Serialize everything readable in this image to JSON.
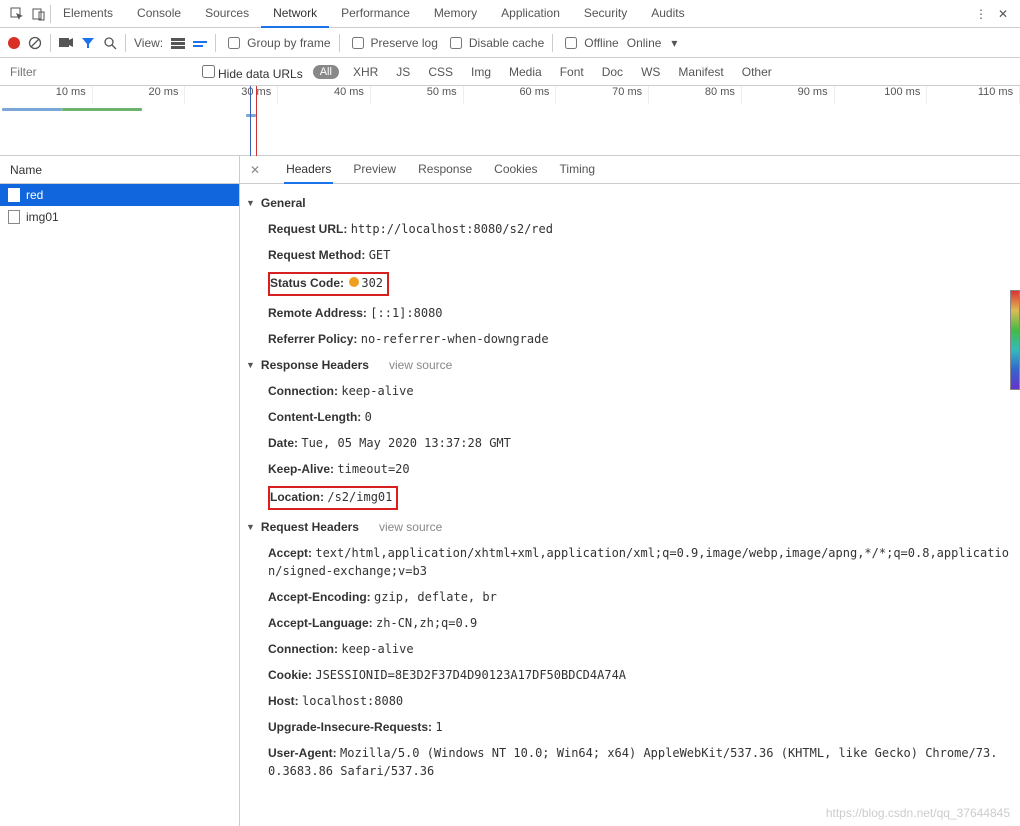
{
  "tabs": {
    "elements": "Elements",
    "console": "Console",
    "sources": "Sources",
    "network": "Network",
    "performance": "Performance",
    "memory": "Memory",
    "application": "Application",
    "security": "Security",
    "audits": "Audits"
  },
  "toolbar": {
    "view": "View:",
    "group_by_frame": "Group by frame",
    "preserve_log": "Preserve log",
    "disable_cache": "Disable cache",
    "offline": "Offline",
    "online": "Online"
  },
  "filterbar": {
    "placeholder": "Filter",
    "hide_data_urls": "Hide data URLs",
    "all": "All",
    "types": [
      "XHR",
      "JS",
      "CSS",
      "Img",
      "Media",
      "Font",
      "Doc",
      "WS",
      "Manifest",
      "Other"
    ]
  },
  "timeline_ticks": [
    "10 ms",
    "20 ms",
    "30 ms",
    "40 ms",
    "50 ms",
    "60 ms",
    "70 ms",
    "80 ms",
    "90 ms",
    "100 ms",
    "110 ms"
  ],
  "names": {
    "header": "Name",
    "items": [
      "red",
      "img01"
    ],
    "selected_index": 0
  },
  "detail_tabs": [
    "Headers",
    "Preview",
    "Response",
    "Cookies",
    "Timing"
  ],
  "general": {
    "title": "General",
    "request_url_k": "Request URL:",
    "request_url_v": "http://localhost:8080/s2/red",
    "request_method_k": "Request Method:",
    "request_method_v": "GET",
    "status_code_k": "Status Code:",
    "status_code_v": "302",
    "remote_addr_k": "Remote Address:",
    "remote_addr_v": "[::1]:8080",
    "referrer_k": "Referrer Policy:",
    "referrer_v": "no-referrer-when-downgrade"
  },
  "resp": {
    "title": "Response Headers",
    "view_source": "view source",
    "connection_k": "Connection:",
    "connection_v": "keep-alive",
    "clen_k": "Content-Length:",
    "clen_v": "0",
    "date_k": "Date:",
    "date_v": "Tue, 05 May 2020 13:37:28 GMT",
    "ka_k": "Keep-Alive:",
    "ka_v": "timeout=20",
    "loc_k": "Location:",
    "loc_v": "/s2/img01"
  },
  "req": {
    "title": "Request Headers",
    "view_source": "view source",
    "accept_k": "Accept:",
    "accept_v": "text/html,application/xhtml+xml,application/xml;q=0.9,image/webp,image/apng,*/*;q=0.8,application/signed-exchange;v=b3",
    "aenc_k": "Accept-Encoding:",
    "aenc_v": "gzip, deflate, br",
    "alang_k": "Accept-Language:",
    "alang_v": "zh-CN,zh;q=0.9",
    "conn_k": "Connection:",
    "conn_v": "keep-alive",
    "cookie_k": "Cookie:",
    "cookie_v": "JSESSIONID=8E3D2F37D4D90123A17DF50BDCD4A74A",
    "host_k": "Host:",
    "host_v": "localhost:8080",
    "uir_k": "Upgrade-Insecure-Requests:",
    "uir_v": "1",
    "ua_k": "User-Agent:",
    "ua_v": "Mozilla/5.0 (Windows NT 10.0; Win64; x64) AppleWebKit/537.36 (KHTML, like Gecko) Chrome/73.0.3683.86 Safari/537.36"
  },
  "watermark": "https://blog.csdn.net/qq_37644845"
}
